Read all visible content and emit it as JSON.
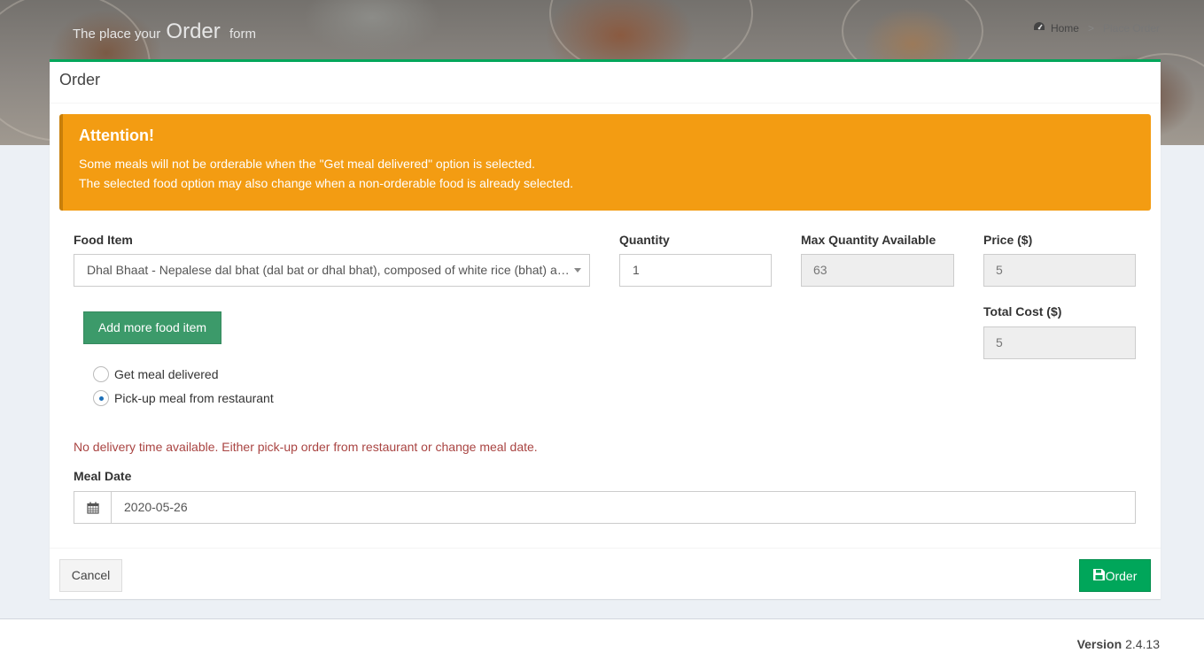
{
  "header": {
    "title_prefix": "The place your",
    "title_highlight": "Order",
    "title_suffix": "form"
  },
  "breadcrumb": {
    "home_icon": "dashboard-icon",
    "home": "Home",
    "current": "Place Order"
  },
  "box": {
    "title": "Order"
  },
  "alert": {
    "title": "Attention!",
    "line1": "Some meals will not be orderable when the \"Get meal delivered\" option is selected.",
    "line2": "The selected food option may also change when a non-orderable food is already selected."
  },
  "form": {
    "food_item_label": "Food Item",
    "food_item_value": "Dhal Bhaat - Nepalese dal bhat (dal bat or dhal bhat), composed of white rice (bhat) and lentil soup (dal)",
    "quantity_label": "Quantity",
    "quantity_value": "1",
    "max_qty_label": "Max Quantity Available",
    "max_qty_value": "63",
    "price_label": "Price ($)",
    "price_value": "5",
    "total_cost_label": "Total Cost ($)",
    "total_cost_value": "5",
    "add_more_label": "Add more food item",
    "radio_delivered": "Get meal delivered",
    "radio_pickup": "Pick-up meal from restaurant",
    "selected_option": "pickup",
    "help_text": "No delivery time available. Either pick-up order from restaurant or change meal date.",
    "meal_date_label": "Meal Date",
    "meal_date_value": "2020-05-26",
    "calendar_icon": "calendar-icon"
  },
  "footer_actions": {
    "cancel_label": "Cancel",
    "order_label": "Order",
    "order_icon": "save-icon"
  },
  "main_footer": {
    "version_label": "Version",
    "version_value": "2.4.13"
  },
  "colors": {
    "accent_green": "#00a65a",
    "warning_orange": "#f39c12",
    "error_red": "#a94442",
    "add_button_green": "#3c9a6a"
  }
}
